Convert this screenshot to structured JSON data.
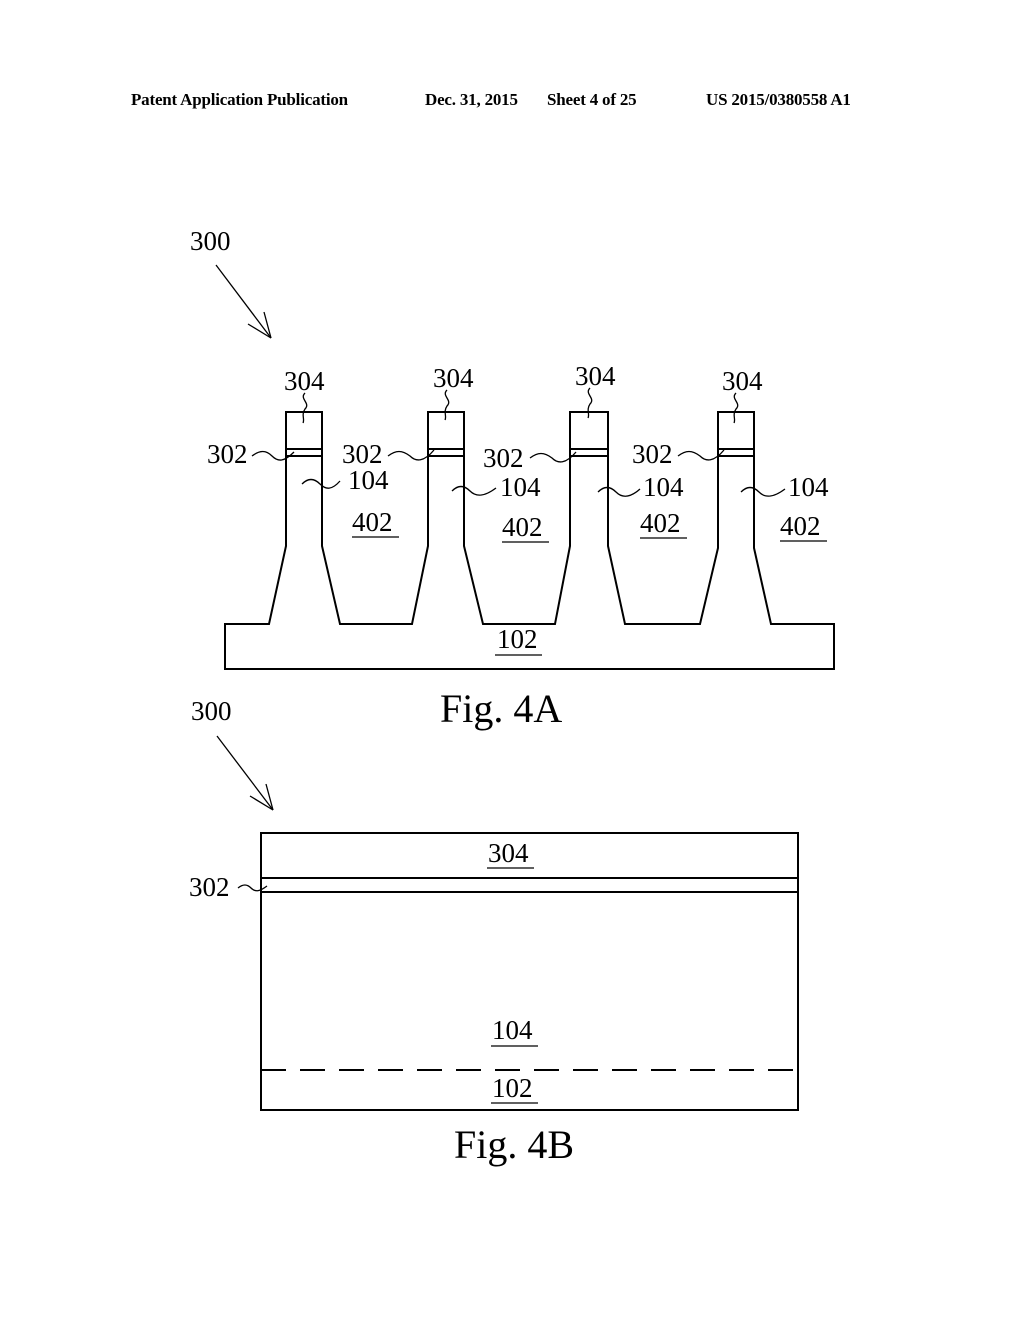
{
  "header": {
    "publication": "Patent Application Publication",
    "date": "Dec. 31, 2015",
    "sheet": "Sheet 4 of 25",
    "number": "US 2015/0380558 A1"
  },
  "fig4a": {
    "caption": "Fig. 4A",
    "device_ref": "300",
    "substrate_ref": "102",
    "fins": [
      {
        "cap_ref": "304",
        "interlayer_ref": "302",
        "fin_ref": "104",
        "isolation_ref": "402"
      },
      {
        "cap_ref": "304",
        "interlayer_ref": "302",
        "fin_ref": "104",
        "isolation_ref": "402"
      },
      {
        "cap_ref": "304",
        "interlayer_ref": "302",
        "fin_ref": "104",
        "isolation_ref": "402"
      },
      {
        "cap_ref": "304",
        "interlayer_ref": "302",
        "fin_ref": "104",
        "isolation_ref": "402"
      }
    ]
  },
  "fig4b": {
    "caption": "Fig. 4B",
    "device_ref": "300",
    "cap_ref": "304",
    "interlayer_ref": "302",
    "fin_ref": "104",
    "substrate_ref": "102"
  }
}
